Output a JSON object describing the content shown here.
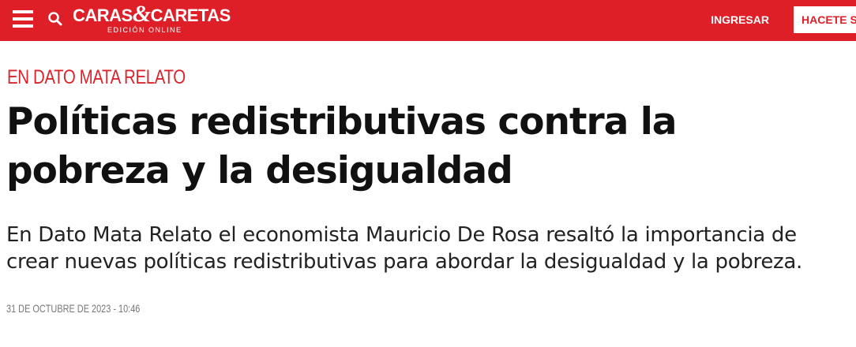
{
  "header": {
    "logo_main_left": "CARAS",
    "logo_amp": "&",
    "logo_main_right": "CARETAS",
    "logo_sub": "EDICIÓN ONLINE",
    "login_label": "INGRESAR",
    "subscribe_label": "HACETE SOCIO",
    "menu_icon": "hamburger-menu-icon",
    "search_icon": "search-icon",
    "bar_color": "#de1f27"
  },
  "article": {
    "kicker": "EN DATO MATA RELATO",
    "title": "Políticas redistributivas contra la pobreza y la desigualdad",
    "summary_line1": "En Dato Mata Relato el economista Mauricio De Rosa resaltó la importancia de",
    "summary_line2": "crear nuevas políticas redistributivas para abordar la desigualdad y la pobreza.",
    "date": "31 DE OCTUBRE DE 2023 - 10:46",
    "kicker_color": "#d9262d"
  }
}
